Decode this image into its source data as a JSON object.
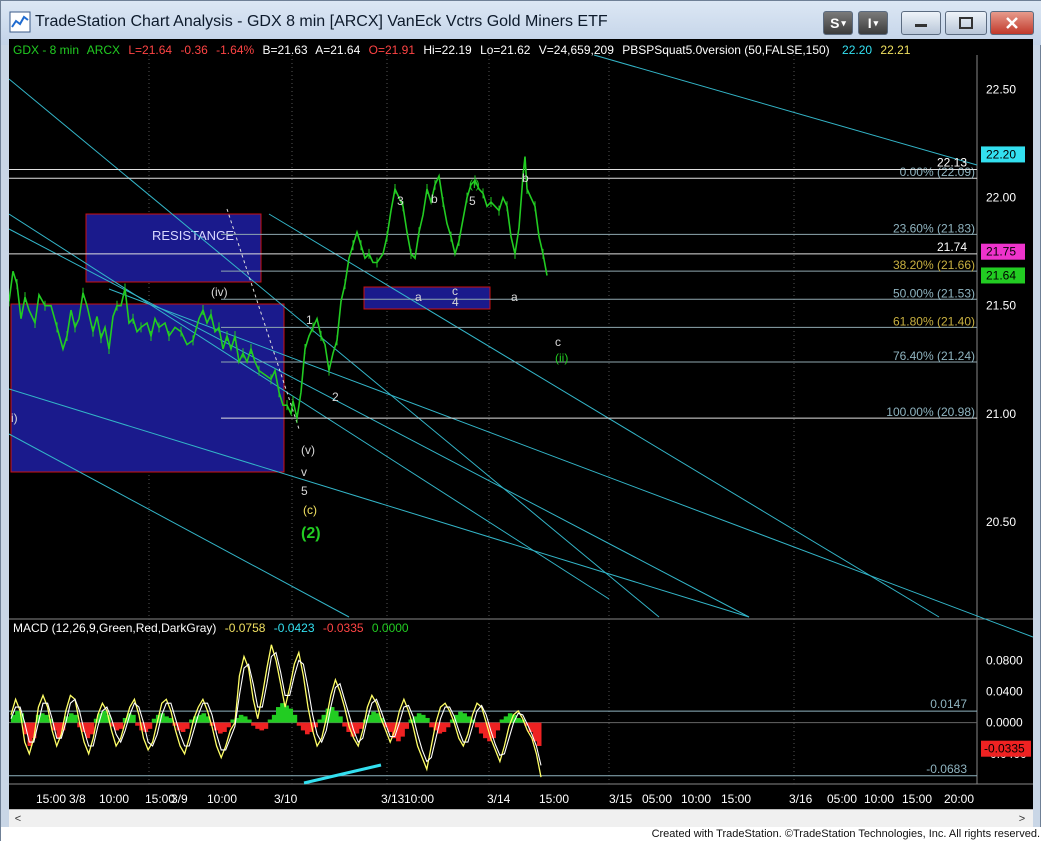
{
  "window": {
    "title": "TradeStation Chart Analysis - GDX 8 min [ARCX] VanEck Vctrs Gold Miners ETF",
    "btn_s": "S",
    "btn_i": "I",
    "footer": "Created with TradeStation. ©TradeStation Technologies, Inc. All rights reserved."
  },
  "header": {
    "symbol": "GDX - 8 min",
    "exchange": "ARCX",
    "last": "L=21.64",
    "change": "-0.36",
    "change_pct": "-1.64%",
    "bid": "B=21.63",
    "ask": "A=21.64",
    "open": "O=21.91",
    "high": "Hi=22.19",
    "low": "Lo=21.62",
    "volume": "V=24,659,209",
    "indicator": "PBSPSquat5.0version (50,FALSE,150)",
    "ind_val1": "22.20",
    "ind_val2": "22.21"
  },
  "macd_legend": {
    "name": "MACD (12,26,9,Green,Red,DarkGray)",
    "v1": "-0.0758",
    "v2": "-0.0423",
    "v3": "-0.0335",
    "v4": "0.0000"
  },
  "colors": {
    "price": "#22cc22",
    "trendline": "#33b5c8",
    "box": "#1a1a8c",
    "box_border": "#cc1111",
    "fib": "#8fa8b0",
    "macd_line": "#ffff66",
    "signal_line": "#ffffff",
    "hist_pos": "#22cc22",
    "hist_neg": "#ee2222",
    "axis_text": "#ffffff",
    "badge_cyan": "#33e0f0",
    "badge_magenta": "#ee33cc",
    "badge_green": "#22cc22",
    "badge_red": "#ee2222"
  },
  "chart_data": {
    "type": "candlestick-line",
    "price_axis": {
      "range": [
        20.06,
        22.66
      ],
      "ticks": [
        "22.50",
        "22.00",
        "21.50",
        "21.00",
        "20.50"
      ]
    },
    "time_axis": {
      "ticks": [
        "15:00",
        "3/8",
        "10:00",
        "15:00",
        "3/9",
        "10:00",
        "3/10",
        "3/13",
        "10:00",
        "3/14",
        "15:00",
        "3/15",
        "05:00",
        "10:00",
        "15:00",
        "3/16",
        "05:00",
        "10:00",
        "15:00",
        "20:00"
      ]
    },
    "price_path": [
      [
        0,
        21.52
      ],
      [
        4,
        21.66
      ],
      [
        8,
        21.6
      ],
      [
        12,
        21.44
      ],
      [
        16,
        21.54
      ],
      [
        20,
        21.48
      ],
      [
        26,
        21.42
      ],
      [
        30,
        21.55
      ],
      [
        36,
        21.5
      ],
      [
        42,
        21.5
      ],
      [
        48,
        21.4
      ],
      [
        54,
        21.3
      ],
      [
        58,
        21.36
      ],
      [
        62,
        21.48
      ],
      [
        66,
        21.4
      ],
      [
        70,
        21.44
      ],
      [
        74,
        21.56
      ],
      [
        78,
        21.5
      ],
      [
        84,
        21.38
      ],
      [
        88,
        21.45
      ],
      [
        92,
        21.35
      ],
      [
        96,
        21.4
      ],
      [
        100,
        21.3
      ],
      [
        104,
        21.45
      ],
      [
        108,
        21.5
      ],
      [
        112,
        21.5
      ],
      [
        116,
        21.58
      ],
      [
        120,
        21.42
      ],
      [
        124,
        21.44
      ],
      [
        128,
        21.38
      ],
      [
        132,
        21.4
      ],
      [
        138,
        21.42
      ],
      [
        142,
        21.36
      ],
      [
        146,
        21.44
      ],
      [
        150,
        21.4
      ],
      [
        156,
        21.42
      ],
      [
        160,
        21.36
      ],
      [
        166,
        21.4
      ],
      [
        172,
        21.38
      ],
      [
        178,
        21.32
      ],
      [
        184,
        21.34
      ],
      [
        190,
        21.44
      ],
      [
        194,
        21.48
      ],
      [
        198,
        21.42
      ],
      [
        202,
        21.46
      ],
      [
        206,
        21.38
      ],
      [
        210,
        21.4
      ],
      [
        214,
        21.3
      ],
      [
        218,
        21.36
      ],
      [
        222,
        21.3
      ],
      [
        226,
        21.36
      ],
      [
        230,
        21.24
      ],
      [
        234,
        21.28
      ],
      [
        238,
        21.24
      ],
      [
        242,
        21.3
      ],
      [
        246,
        21.24
      ],
      [
        250,
        21.2
      ],
      [
        256,
        21.18
      ],
      [
        262,
        21.16
      ],
      [
        266,
        21.2
      ],
      [
        270,
        21.1
      ],
      [
        274,
        21.04
      ],
      [
        278,
        21.04
      ],
      [
        282,
        21.0
      ],
      [
        284,
        21.06
      ],
      [
        286,
        21.02
      ],
      [
        288,
        20.98
      ],
      [
        292,
        21.1
      ],
      [
        296,
        21.3
      ],
      [
        300,
        21.36
      ],
      [
        304,
        21.4
      ],
      [
        308,
        21.44
      ],
      [
        312,
        21.36
      ],
      [
        316,
        21.32
      ],
      [
        320,
        21.2
      ],
      [
        324,
        21.28
      ],
      [
        328,
        21.34
      ],
      [
        332,
        21.52
      ],
      [
        336,
        21.6
      ],
      [
        340,
        21.72
      ],
      [
        344,
        21.78
      ],
      [
        348,
        21.84
      ],
      [
        352,
        21.78
      ],
      [
        356,
        21.72
      ],
      [
        360,
        21.74
      ],
      [
        364,
        21.7
      ],
      [
        368,
        21.7
      ],
      [
        374,
        21.74
      ],
      [
        378,
        21.82
      ],
      [
        382,
        21.94
      ],
      [
        386,
        22.04
      ],
      [
        390,
        22.0
      ],
      [
        394,
        21.96
      ],
      [
        398,
        21.84
      ],
      [
        402,
        21.74
      ],
      [
        406,
        21.72
      ],
      [
        410,
        21.84
      ],
      [
        414,
        21.92
      ],
      [
        418,
        22.04
      ],
      [
        422,
        21.98
      ],
      [
        426,
        22.06
      ],
      [
        430,
        22.1
      ],
      [
        434,
        21.98
      ],
      [
        438,
        21.88
      ],
      [
        442,
        21.82
      ],
      [
        446,
        21.74
      ],
      [
        450,
        21.8
      ],
      [
        454,
        21.9
      ],
      [
        458,
        22.0
      ],
      [
        462,
        22.06
      ],
      [
        466,
        22.08
      ],
      [
        470,
        22.04
      ],
      [
        474,
        22.02
      ],
      [
        478,
        21.96
      ],
      [
        482,
        21.98
      ],
      [
        486,
        21.96
      ],
      [
        490,
        21.94
      ],
      [
        494,
        22.0
      ],
      [
        498,
        21.96
      ],
      [
        502,
        21.82
      ],
      [
        506,
        21.74
      ],
      [
        510,
        21.86
      ],
      [
        514,
        22.1
      ],
      [
        516,
        22.19
      ],
      [
        518,
        22.04
      ],
      [
        522,
        22.0
      ],
      [
        526,
        21.96
      ],
      [
        530,
        21.82
      ],
      [
        534,
        21.74
      ],
      [
        538,
        21.64
      ]
    ],
    "fib_levels": [
      {
        "label": "0.00% (22.09)",
        "value": 22.09
      },
      {
        "label": "23.60% (21.83)",
        "value": 21.83
      },
      {
        "label": "38.20% (21.66)",
        "value": 21.66
      },
      {
        "label": "50.00% (21.53)",
        "value": 21.53
      },
      {
        "label": "61.80% (21.40)",
        "value": 21.4
      },
      {
        "label": "76.40% (21.24)",
        "value": 21.24
      },
      {
        "label": "100.00% (20.98)",
        "value": 20.98
      }
    ],
    "price_labels": [
      {
        "text": "22.13",
        "value": 22.13
      },
      {
        "text": "21.74",
        "value": 21.74
      }
    ],
    "price_badges": [
      {
        "text": "22.20",
        "value": 22.2,
        "color": "#33e0f0"
      },
      {
        "text": "21.75",
        "value": 21.75,
        "color": "#ee33cc"
      },
      {
        "text": "21.64",
        "value": 21.64,
        "color": "#22cc22"
      }
    ],
    "resistance_label": "RESISTANCE",
    "wave_labels": [
      {
        "text": "(iv)",
        "color": "#d8d8d8"
      },
      {
        "text": "1",
        "color": "#d8d8d8"
      },
      {
        "text": "2",
        "color": "#d8d8d8"
      },
      {
        "text": "3",
        "color": "#d8d8d8"
      },
      {
        "text": "b",
        "color": "#d8d8d8"
      },
      {
        "text": "(i)",
        "color": "#22cc22"
      },
      {
        "text": "5",
        "color": "#d8d8d8"
      },
      {
        "text": "b",
        "color": "#d8d8d8"
      },
      {
        "text": "a",
        "color": "#d8d8d8"
      },
      {
        "text": "c",
        "color": "#d8d8d8"
      },
      {
        "text": "4",
        "color": "#d8d8d8"
      },
      {
        "text": "a",
        "color": "#d8d8d8"
      },
      {
        "text": "c",
        "color": "#d8d8d8"
      },
      {
        "text": "(ii)",
        "color": "#22cc22"
      },
      {
        "text": "i)",
        "color": "#d8d8d8"
      },
      {
        "text": "(v)",
        "color": "#d8d8d8"
      },
      {
        "text": "v",
        "color": "#d8d8d8"
      },
      {
        "text": "5",
        "color": "#d8d8d8"
      },
      {
        "text": "(c)",
        "color": "#f0e060"
      },
      {
        "text": "(2)",
        "color": "#22cc22"
      }
    ],
    "macd": {
      "axis_ticks": [
        "0.0800",
        "0.0400",
        "0.0000",
        "-0.0400"
      ],
      "range": [
        -0.075,
        0.11
      ],
      "levels": [
        {
          "text": "0.0147",
          "value": 0.0147
        },
        {
          "text": "-0.0683",
          "value": -0.0683
        }
      ],
      "badge": {
        "text": "-0.0335",
        "value": -0.0335
      },
      "histogram": [
        0.01,
        0.015,
        0.012,
        -0.015,
        -0.03,
        -0.02,
        0.01,
        0.012,
        0.01,
        0.005,
        -0.01,
        -0.02,
        -0.01,
        0.008,
        0.012,
        0.01,
        -0.006,
        -0.012,
        -0.02,
        -0.015,
        0.005,
        0.012,
        0.015,
        0.01,
        -0.005,
        -0.01,
        -0.008,
        0.006,
        0.012,
        0.01,
        -0.004,
        -0.01,
        -0.012,
        -0.008,
        0.005,
        0.01,
        0.012,
        0.008,
        0.006,
        -0.004,
        -0.01,
        -0.012,
        -0.008,
        0.004,
        0.008,
        0.01,
        0.012,
        0.008,
        -0.004,
        -0.01,
        -0.014,
        -0.012,
        -0.006,
        0.004,
        0.006,
        0.01,
        0.008,
        0.004,
        -0.004,
        -0.008,
        -0.01,
        -0.008,
        0.004,
        0.01,
        0.02,
        0.025,
        0.022,
        0.018,
        0.01,
        -0.004,
        -0.01,
        -0.015,
        -0.012,
        -0.006,
        0.004,
        0.01,
        0.018,
        0.02,
        0.015,
        0.008,
        -0.005,
        -0.012,
        -0.018,
        -0.014,
        -0.008,
        0.004,
        0.01,
        0.014,
        0.012,
        0.006,
        -0.006,
        -0.012,
        -0.02,
        -0.024,
        -0.018,
        -0.008,
        0.004,
        0.008,
        0.012,
        0.01,
        0.006,
        -0.006,
        -0.01,
        -0.014,
        -0.012,
        -0.006,
        0.004,
        0.01,
        0.014,
        0.012,
        0.008,
        0.004,
        -0.006,
        -0.014,
        -0.02,
        -0.024,
        -0.02,
        -0.01,
        0.004,
        0.008,
        0.012,
        0.01,
        0.006,
        0.004,
        -0.004,
        -0.012,
        -0.024,
        -0.03
      ],
      "macd_line": [
        0.01,
        0.03,
        0.015,
        -0.025,
        -0.04,
        -0.02,
        0.02,
        0.035,
        0.02,
        -0.01,
        -0.03,
        -0.015,
        0.015,
        0.035,
        0.03,
        0.0,
        -0.025,
        -0.04,
        -0.02,
        0.01,
        0.025,
        0.015,
        -0.01,
        -0.03,
        -0.02,
        0.0,
        0.02,
        0.03,
        0.01,
        -0.02,
        -0.035,
        -0.025,
        0.0,
        0.025,
        0.03,
        0.015,
        -0.01,
        -0.03,
        -0.04,
        -0.02,
        0.005,
        0.02,
        0.03,
        0.015,
        -0.005,
        -0.03,
        -0.045,
        -0.03,
        -0.01,
        0.0,
        0.06,
        0.085,
        0.07,
        0.03,
        0.005,
        0.035,
        0.07,
        0.1,
        0.08,
        0.05,
        0.02,
        0.045,
        0.075,
        0.09,
        0.06,
        0.02,
        -0.01,
        -0.03,
        -0.02,
        0.005,
        0.035,
        0.055,
        0.04,
        0.02,
        -0.005,
        -0.02,
        -0.03,
        -0.01,
        0.02,
        0.035,
        0.025,
        0.005,
        -0.01,
        -0.025,
        -0.01,
        0.015,
        0.03,
        0.015,
        -0.005,
        -0.03,
        -0.045,
        -0.06,
        -0.03,
        0.0,
        0.02,
        0.025,
        0.015,
        0.0,
        -0.02,
        -0.03,
        -0.015,
        0.01,
        0.025,
        0.02,
        0.0,
        -0.02,
        -0.035,
        -0.05,
        -0.03,
        -0.005,
        0.01,
        0.015,
        0.005,
        -0.01,
        -0.02,
        -0.04,
        -0.07
      ],
      "signal_line": [
        0.005,
        0.02,
        0.02,
        0.0,
        -0.025,
        -0.025,
        0.0,
        0.025,
        0.025,
        0.005,
        -0.02,
        -0.02,
        0.0,
        0.025,
        0.03,
        0.015,
        -0.01,
        -0.03,
        -0.03,
        -0.005,
        0.015,
        0.02,
        0.005,
        -0.015,
        -0.025,
        -0.01,
        0.01,
        0.025,
        0.02,
        0.0,
        -0.025,
        -0.03,
        -0.015,
        0.01,
        0.025,
        0.025,
        0.005,
        -0.015,
        -0.03,
        -0.03,
        -0.01,
        0.01,
        0.025,
        0.025,
        0.01,
        -0.015,
        -0.035,
        -0.035,
        -0.02,
        -0.005,
        0.035,
        0.07,
        0.075,
        0.05,
        0.02,
        0.02,
        0.05,
        0.085,
        0.09,
        0.065,
        0.035,
        0.035,
        0.06,
        0.08,
        0.075,
        0.045,
        0.01,
        -0.015,
        -0.025,
        -0.01,
        0.02,
        0.045,
        0.05,
        0.03,
        0.01,
        -0.01,
        -0.025,
        -0.02,
        0.005,
        0.025,
        0.03,
        0.015,
        -0.002,
        -0.018,
        -0.018,
        0.0,
        0.02,
        0.022,
        0.008,
        -0.015,
        -0.035,
        -0.05,
        -0.045,
        -0.02,
        0.005,
        0.02,
        0.02,
        0.008,
        -0.01,
        -0.025,
        -0.025,
        -0.005,
        0.015,
        0.022,
        0.01,
        -0.01,
        -0.028,
        -0.042,
        -0.04,
        -0.02,
        0.0,
        0.012,
        0.01,
        -0.002,
        -0.015,
        -0.03,
        -0.055
      ]
    }
  }
}
